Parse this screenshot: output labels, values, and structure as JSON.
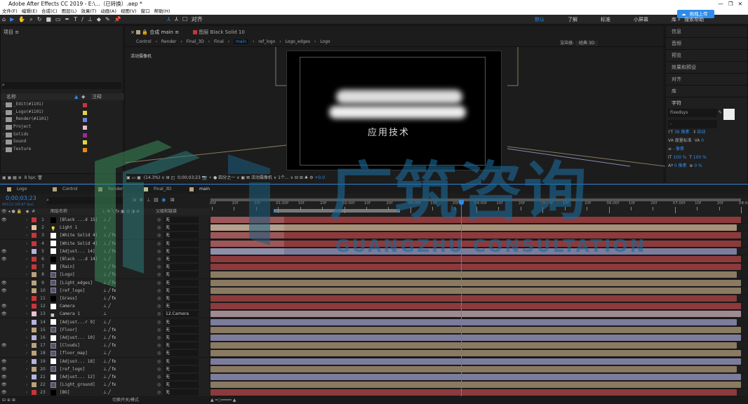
{
  "window": {
    "title": "Adobe After Effects CC 2019 - E:\\...（已转换）.aep *"
  },
  "menu": [
    "文件(F)",
    "编辑(E)",
    "合成(C)",
    "图层(L)",
    "效果(T)",
    "动画(A)",
    "视图(V)",
    "窗口",
    "帮助(H)"
  ],
  "toolbar": {
    "snap_label": "对齐",
    "workspaces": [
      "默认",
      "了解",
      "标准",
      "小屏幕",
      "库"
    ],
    "search_placeholder": "搜索帮助",
    "upload_label": "拖拽上传"
  },
  "project": {
    "title": "项目",
    "col_name": "名称",
    "col_comment": "注释",
    "items": [
      {
        "name": "_Edit(#1101)",
        "color": "#c8353a"
      },
      {
        "name": "_Logo(#1101)",
        "color": "#e5d23c"
      },
      {
        "name": "_Render(#1101)",
        "color": "#6c86d8"
      },
      {
        "name": "Project",
        "color": "#e8bccc"
      },
      {
        "name": "Solids",
        "color": "#9a2b9a"
      },
      {
        "name": "Sound",
        "color": "#e5d23c"
      },
      {
        "name": "Texture",
        "color": "#e58a17"
      }
    ],
    "bpc": "8 bpc"
  },
  "viewer": {
    "comp_tab": "合成 main",
    "layer_tab": "图层 Black Solid 10",
    "breadcrumbs": [
      "Control",
      "Render",
      "Final_3D",
      "Final",
      "main",
      "ref_logo",
      "Logo_edges",
      "Logo"
    ],
    "active_breadcrumb": "main",
    "renderer_label": "渲染器:",
    "renderer": "经典 3D",
    "camera_label": "活动摄像机",
    "overlay_text": "应用技术",
    "zoom": "(14.3%)",
    "timecode": "0;00;03;23",
    "resolution": "四分之一",
    "view": "活动摄像机",
    "views": "1个...",
    "exposure": "+0.0"
  },
  "right_panel": {
    "items": [
      "信息",
      "音频",
      "预览",
      "效果和预设",
      "对齐",
      "库"
    ],
    "character": {
      "title": "字符",
      "font": "Fixedsys",
      "style": "-",
      "size": "36 像素",
      "leading": "自动",
      "kerning": "度量标准",
      "tracking": "0",
      "stroke": "- 像素",
      "vscale": "100 %",
      "hscale": "100 %",
      "baseline": "0 像素",
      "tsume": "0 %"
    }
  },
  "timeline": {
    "tabs": [
      "Logo",
      "Control",
      "Render",
      "Final_3D",
      "main"
    ],
    "active_tab": "main",
    "tab_colors": [
      "#b9a27d",
      "#b9a27d",
      "#b9a27d",
      "#b0c090",
      "#b9a27d"
    ],
    "timecode": "0;00;03;23",
    "frames": "00113 (29.97 fps)",
    "col_layer_name": "图层名称",
    "col_parent": "父级和链接",
    "toggle_label": "切换开关/模式",
    "ruler": [
      "00f",
      "10f",
      "20f",
      "01:00f",
      "10f",
      "20f",
      "02:00f",
      "10f",
      "20f",
      "03:00f",
      "10f",
      "20f",
      "04:00f",
      "10f",
      "20f",
      "05:00f",
      "10f",
      "20f",
      "06:00f",
      "10f",
      "20f",
      "07:00f",
      "10f",
      "20f",
      "08:00"
    ],
    "playhead_seconds": 3.77,
    "duration_seconds": 8,
    "layers": [
      {
        "n": "1",
        "name": "[Black ...d 15]",
        "label": "#c8353a",
        "src": "black",
        "eye": true,
        "parent": "无",
        "fx": false
      },
      {
        "n": "2",
        "name": "Light 1",
        "label": "#e8c2a0",
        "src": "light",
        "eye": false,
        "parent": "无",
        "fx": false
      },
      {
        "n": "3",
        "name": "[White Solid 4]",
        "label": "#c8353a",
        "src": "white",
        "eye": false,
        "parent": "无",
        "fx": true
      },
      {
        "n": "4",
        "name": "[White Solid 4]",
        "label": "#c8353a",
        "src": "white",
        "eye": false,
        "parent": "无",
        "fx": true
      },
      {
        "n": "5",
        "name": "[Adjust... 14]",
        "label": "#b4b4dc",
        "src": "white",
        "eye": true,
        "parent": "无",
        "fx": true
      },
      {
        "n": "6",
        "name": "[Black ...d 14]",
        "label": "#c8353a",
        "src": "black",
        "eye": true,
        "parent": "无",
        "fx": false
      },
      {
        "n": "7",
        "name": "[Rain]",
        "label": "#c8353a",
        "src": "white",
        "eye": false,
        "parent": "无",
        "fx": true
      },
      {
        "n": "8",
        "name": "[Logo]",
        "label": "#b9a27d",
        "src": "comp",
        "eye": false,
        "parent": "无",
        "fx": true
      },
      {
        "n": "9",
        "name": "[Light_edges]",
        "label": "#b9a27d",
        "src": "comp",
        "eye": true,
        "parent": "无",
        "fx": true
      },
      {
        "n": "10",
        "name": "[ref_logo]",
        "label": "#b9a27d",
        "src": "comp",
        "eye": true,
        "parent": "无",
        "fx": true
      },
      {
        "n": "11",
        "name": "[Grass]",
        "label": "#c8353a",
        "src": "black",
        "eye": false,
        "parent": "无",
        "fx": true
      },
      {
        "n": "12",
        "name": "Camera",
        "label": "#c8353a",
        "src": "white",
        "eye": true,
        "parent": "无",
        "fx": false
      },
      {
        "n": "13",
        "name": "Camera 1",
        "label": "#e8c0d0",
        "src": "camera",
        "eye": true,
        "parent": "12.Camera",
        "fx": false
      },
      {
        "n": "14",
        "name": "[Adjust...r 9]",
        "label": "#b4b4dc",
        "src": "white",
        "eye": false,
        "parent": "无",
        "fx": false
      },
      {
        "n": "15",
        "name": "[Floor]",
        "label": "#b9a27d",
        "src": "comp",
        "eye": false,
        "parent": "无",
        "fx": true
      },
      {
        "n": "16",
        "name": "[Adjust... 10]",
        "label": "#b4b4dc",
        "src": "white",
        "eye": false,
        "parent": "无",
        "fx": true
      },
      {
        "n": "17",
        "name": "[Clouds]",
        "label": "#b9a27d",
        "src": "comp",
        "eye": true,
        "parent": "无",
        "fx": true
      },
      {
        "n": "18",
        "name": "[floor_map]",
        "label": "#b9a27d",
        "src": "comp",
        "eye": false,
        "parent": "无",
        "fx": false
      },
      {
        "n": "19",
        "name": "[Adjust... 18]",
        "label": "#b4b4dc",
        "src": "white",
        "eye": true,
        "parent": "无",
        "fx": true
      },
      {
        "n": "20",
        "name": "[ref_logo]",
        "label": "#b9a27d",
        "src": "comp",
        "eye": true,
        "parent": "无",
        "fx": true
      },
      {
        "n": "21",
        "name": "[Adjust... 12]",
        "label": "#b4b4dc",
        "src": "white",
        "eye": true,
        "parent": "无",
        "fx": true
      },
      {
        "n": "22",
        "name": "[Light_ground]",
        "label": "#b9a27d",
        "src": "comp",
        "eye": true,
        "parent": "无",
        "fx": true
      },
      {
        "n": "23",
        "name": "[BG]",
        "label": "#c8353a",
        "src": "black",
        "eye": true,
        "parent": "无",
        "fx": false
      }
    ]
  },
  "watermark": {
    "cn": "广筑咨询",
    "en": "GUANGZHU CONSULTATION"
  },
  "colors": {
    "accent": "#2d8ceb",
    "bar_red": "#8c3a3c",
    "bar_tan": "#8a7a62",
    "bar_lav": "#7c7c9c",
    "bar_peach": "#a89078",
    "bar_pink": "#a08a92"
  }
}
